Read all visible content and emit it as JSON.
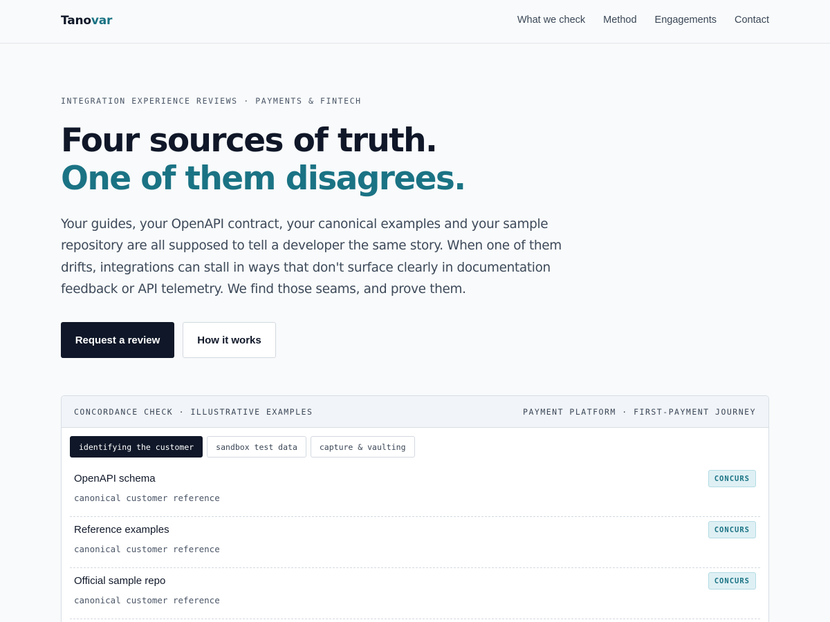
{
  "brand": {
    "name_part1": "Tano",
    "name_part2": "var"
  },
  "nav": {
    "links": [
      "What we check",
      "Method",
      "Engagements",
      "Contact"
    ]
  },
  "hero": {
    "eyebrow": "INTEGRATION EXPERIENCE REVIEWS · PAYMENTS & FINTECH",
    "headline_plain": "Four sources of truth. ",
    "headline_accent": "One of them disagrees.",
    "lede": "Your guides, your OpenAPI contract, your canonical examples and your sample repository are all supposed to tell a developer the same story. When one of them drifts, integrations can stall in ways that don't surface clearly in documentation feedback or API telemetry. We find those seams, and prove them.",
    "primary_cta": "Request a review",
    "secondary_cta": "How it works"
  },
  "panel": {
    "title_left": "CONCORDANCE CHECK · ILLUSTRATIVE EXAMPLES",
    "title_right": "PAYMENT PLATFORM · FIRST-PAYMENT JOURNEY",
    "tabs": [
      "identifying the customer",
      "sandbox test data",
      "capture & vaulting"
    ],
    "active_tab": "identifying the customer",
    "rows": [
      {
        "title": "OpenAPI schema",
        "detail": "canonical customer reference",
        "status": "CONCURS"
      },
      {
        "title": "Reference examples",
        "detail": "canonical customer reference",
        "status": "CONCURS"
      },
      {
        "title": "Official sample repo",
        "detail": "canonical customer reference",
        "status": "CONCURS"
      }
    ]
  },
  "colors": {
    "accent": "#1a7384",
    "ink": "#0f1728",
    "badge_bg": "#dff0f4"
  }
}
